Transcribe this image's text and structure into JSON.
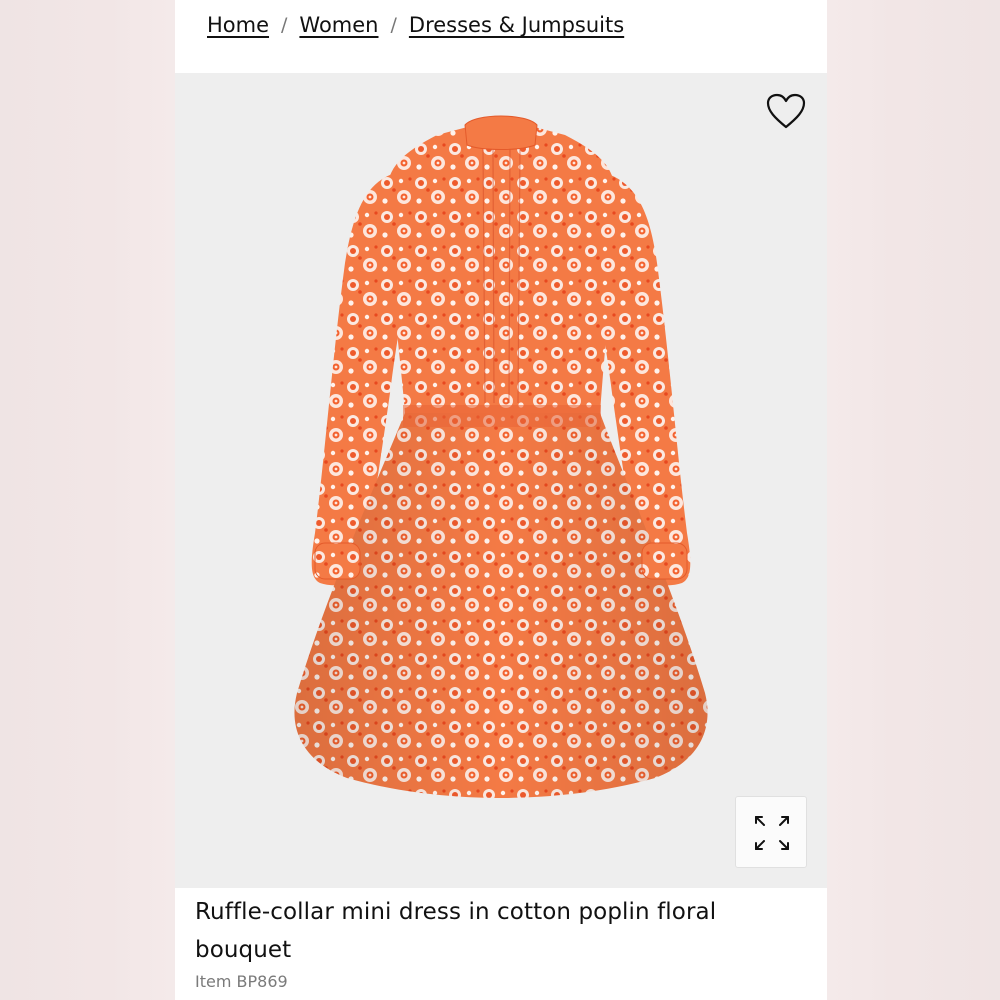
{
  "breadcrumb": {
    "items": [
      "Home",
      "Women",
      "Dresses & Jumpsuits"
    ],
    "separator": "/"
  },
  "product": {
    "title": "Ruffle-collar mini dress in cotton poplin floral bouquet",
    "item_number": "Item BP869",
    "image_alt": "Orange floral print long-sleeve mini dress"
  },
  "icons": {
    "wishlist": "heart-icon",
    "expand": "expand-icon"
  },
  "colors": {
    "page_background": "#efe3e3",
    "media_background": "#eeeeee",
    "dress_primary": "#f06a3a",
    "dress_secondary": "#ffffff"
  }
}
